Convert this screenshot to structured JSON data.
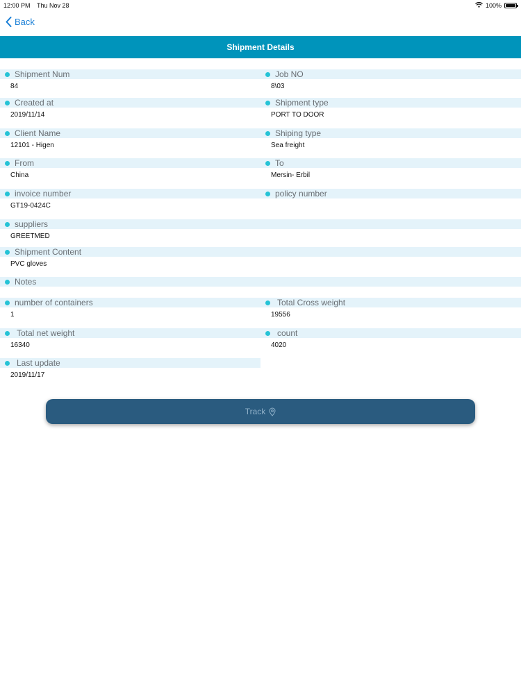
{
  "status_bar": {
    "time": "12:00 PM",
    "date": "Thu Nov 28",
    "battery": "100%",
    "battery_level": 1.0
  },
  "nav": {
    "back_label": "Back"
  },
  "header": {
    "title": "Shipment Details"
  },
  "fields": {
    "shipment_num": {
      "label": "Shipment Num",
      "value": "84"
    },
    "job_no": {
      "label": "Job NO",
      "value": "8\\03"
    },
    "created_at": {
      "label": "Created at",
      "value": "2019/11/14"
    },
    "shipment_type": {
      "label": "Shipment type",
      "value": "PORT TO DOOR"
    },
    "client_name": {
      "label": "Client Name",
      "value": "12101 - Higen"
    },
    "shiping_type": {
      "label": "Shiping type",
      "value": "Sea freight"
    },
    "from": {
      "label": "From",
      "value": "China"
    },
    "to": {
      "label": "To",
      "value": "Mersin- Erbil"
    },
    "invoice_number": {
      "label": "invoice number",
      "value": "GT19-0424C"
    },
    "policy_number": {
      "label": "policy number",
      "value": ""
    },
    "suppliers": {
      "label": "suppliers",
      "value": "GREETMED"
    },
    "shipment_content": {
      "label": "Shipment Content",
      "value": "PVC gloves"
    },
    "notes": {
      "label": "Notes",
      "value": ""
    },
    "number_of_containers": {
      "label": "number of containers",
      "value": "1"
    },
    "total_cross_weight": {
      "label": "Total Cross weight",
      "value": "19556"
    },
    "total_net_weight": {
      "label": "Total net weight",
      "value": "16340"
    },
    "count": {
      "label": "count",
      "value": "4020"
    },
    "last_update": {
      "label": "Last update",
      "value": "2019/11/17"
    }
  },
  "actions": {
    "track_label": "Track"
  },
  "colors": {
    "header_bg": "#0094bb",
    "label_bg": "#e4f3fa",
    "dot": "#25c3d6",
    "back_link": "#1a7fd6",
    "track_button_bg": "#2a5b7f"
  }
}
